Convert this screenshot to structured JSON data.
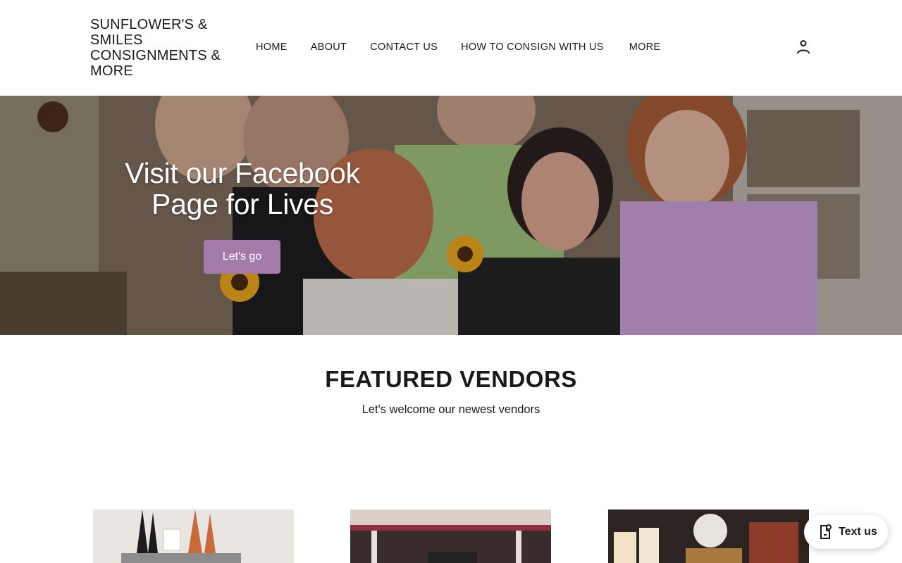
{
  "header": {
    "brand_line1": "SUNFLOWER'S &",
    "brand_line2": "SMILES",
    "brand_line3": "CONSIGNMENTS &",
    "brand_line4": "MORE",
    "nav": [
      {
        "label": "HOME"
      },
      {
        "label": "ABOUT"
      },
      {
        "label": "CONTACT US"
      },
      {
        "label": "HOW TO CONSIGN WITH US"
      },
      {
        "label": "MORE"
      }
    ],
    "account_icon": "account-icon"
  },
  "hero": {
    "title_line1": "Visit our Facebook",
    "title_line2": "Page for Lives",
    "button_label": "Let's go",
    "button_color": "#a47aa8"
  },
  "featured": {
    "title": "FEATURED VENDORS",
    "subtitle": "Let's welcome our newest vendors"
  },
  "chat_widget": {
    "label": "Text us",
    "icon": "chat-phone-icon"
  }
}
